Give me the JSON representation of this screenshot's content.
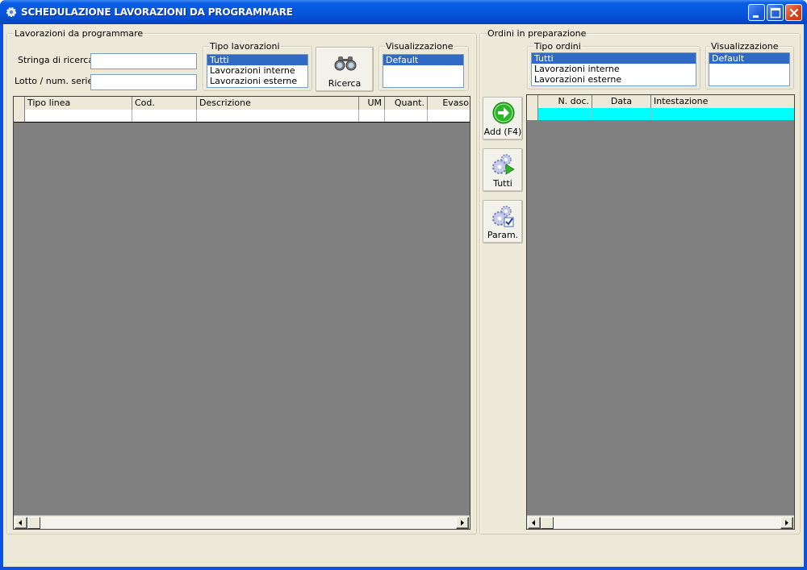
{
  "window": {
    "title": "SCHEDULAZIONE LAVORAZIONI DA PROGRAMMARE"
  },
  "left": {
    "group_label": "Lavorazioni da programmare",
    "search_label": "Stringa di ricerca :",
    "search_value": "",
    "lot_label": "Lotto / num. serie :",
    "lot_value": "",
    "type_group_label": "Tipo lavorazioni",
    "type_items": [
      "Tutti",
      "Lavorazioni interne",
      "Lavorazioni esterne"
    ],
    "view_group_label": "Visualizzazione",
    "view_items": [
      "Default"
    ],
    "search_button": "Ricerca",
    "columns": [
      "Tipo linea",
      "Cod.",
      "Descrizione",
      "UM",
      "Quant.",
      "Evaso"
    ]
  },
  "middle": {
    "add_button": "Add (F4)",
    "all_button": "Tutti",
    "params_button": "Param."
  },
  "right": {
    "group_label": "Ordini in preparazione",
    "type_group_label": "Tipo ordini",
    "type_items": [
      "Tutti",
      "Lavorazioni interne",
      "Lavorazioni esterne"
    ],
    "view_group_label": "Visualizzazione",
    "view_items": [
      "Default"
    ],
    "columns": [
      "N. doc.",
      "Data",
      "Intestazione"
    ]
  },
  "colors": {
    "titlebar": "#0558de",
    "selection": "#316ac5",
    "grid_empty": "#808080",
    "active_row": "#00ffff"
  }
}
